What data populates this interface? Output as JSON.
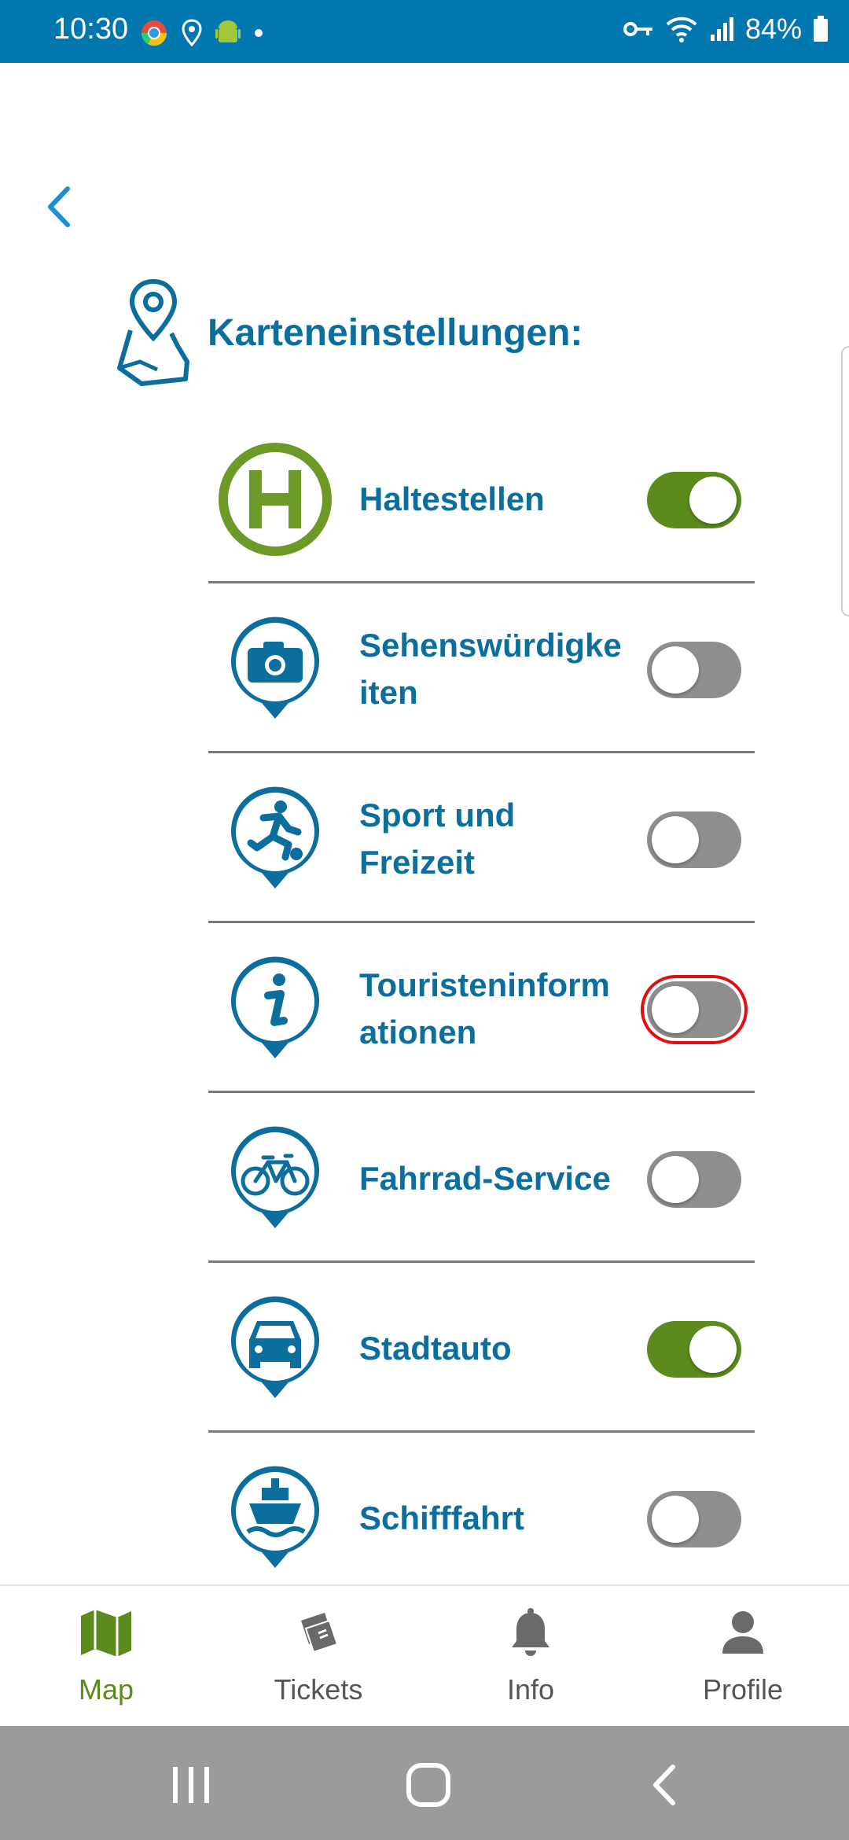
{
  "status_bar": {
    "time": "10:30",
    "battery": "84%"
  },
  "header": {
    "title": "Karteneinstellungen:"
  },
  "settings": [
    {
      "label": "Haltestellen",
      "icon": "bus-stop-icon",
      "on": true
    },
    {
      "label": "Sehenswürdigke\niten",
      "icon": "camera-icon",
      "on": false
    },
    {
      "label": "Sport und\nFreizeit",
      "icon": "football-icon",
      "on": false
    },
    {
      "label": "Touristeninform\nationen",
      "icon": "info-icon",
      "on": false
    },
    {
      "label": "Fahrrad-Service",
      "icon": "bicycle-icon",
      "on": false
    },
    {
      "label": "Stadtauto",
      "icon": "car-icon",
      "on": true
    },
    {
      "label": "Schifffahrt",
      "icon": "ship-icon",
      "on": false
    }
  ],
  "bottom_nav": {
    "map": "Map",
    "tickets": "Tickets",
    "info": "Info",
    "profile": "Profile"
  },
  "colors": {
    "brand_blue": "#0b6e9c",
    "green": "#5b8a1d",
    "status_bar": "#0077ae"
  }
}
